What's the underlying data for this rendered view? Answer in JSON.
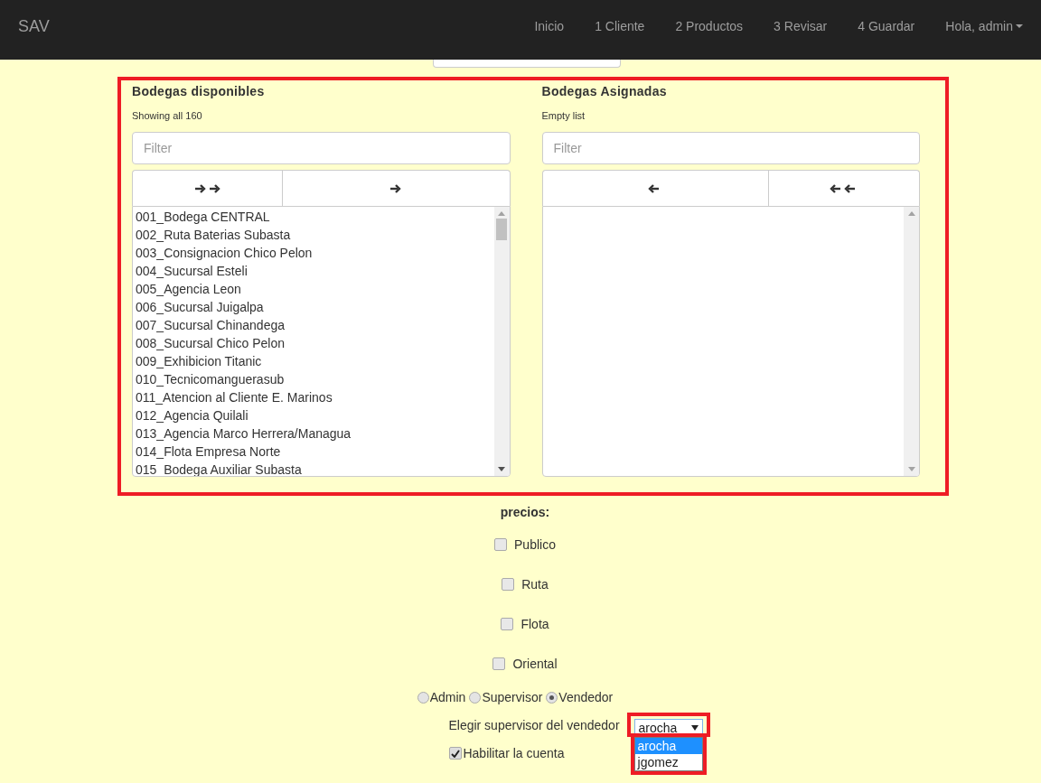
{
  "navbar": {
    "brand": "SAV",
    "links": [
      {
        "label": "Inicio"
      },
      {
        "label": "1 Cliente"
      },
      {
        "label": "2 Productos"
      },
      {
        "label": "3 Revisar"
      },
      {
        "label": "4 Guardar"
      }
    ],
    "user_menu": "Hola, admin"
  },
  "bodegas": {
    "highlighted": true,
    "panels": [
      {
        "title": "Bodegas disponibles",
        "status": "Showing all 160",
        "filter_placeholder": "Filter",
        "buttons": [
          {
            "kind": "double_right"
          },
          {
            "kind": "right"
          }
        ],
        "items": [
          "001_Bodega CENTRAL",
          "002_Ruta Baterias Subasta",
          "003_Consignacion Chico Pelon",
          "004_Sucursal Esteli",
          "005_Agencia Leon",
          "006_Sucursal Juigalpa",
          "007_Sucursal Chinandega",
          "008_Sucursal Chico Pelon",
          "009_Exhibicion Titanic",
          "010_Tecnicomanguerasub",
          "011_Atencion al Cliente E. Marinos",
          "012_Agencia Quilali",
          "013_Agencia Marco Herrera/Managua",
          "014_Flota Empresa Norte",
          "015_Bodega Auxiliar Subasta"
        ]
      },
      {
        "title": "Bodegas Asignadas",
        "status": "Empty list",
        "filter_placeholder": "Filter",
        "buttons": [
          {
            "kind": "left"
          },
          {
            "kind": "double_left"
          }
        ]
      }
    ]
  },
  "prices": {
    "title": "precios:",
    "options": [
      {
        "label": "Publico",
        "checked": false
      },
      {
        "label": "Ruta",
        "checked": false
      },
      {
        "label": "Flota",
        "checked": false
      },
      {
        "label": "Oriental",
        "checked": false
      }
    ]
  },
  "roles": [
    {
      "label": "Admin",
      "selected": false
    },
    {
      "label": "Supervisor",
      "selected": false
    },
    {
      "label": "Vendedor",
      "selected": true
    }
  ],
  "supervisor": {
    "label": "Elegir supervisor del vendedor",
    "value": "arocha",
    "expanded": true,
    "highlighted": true,
    "options": [
      {
        "label": "arocha",
        "selected": true
      },
      {
        "label": "jgomez",
        "selected": false
      }
    ]
  },
  "enable_account": {
    "label": "Habilitar la cuenta",
    "checked": true
  }
}
